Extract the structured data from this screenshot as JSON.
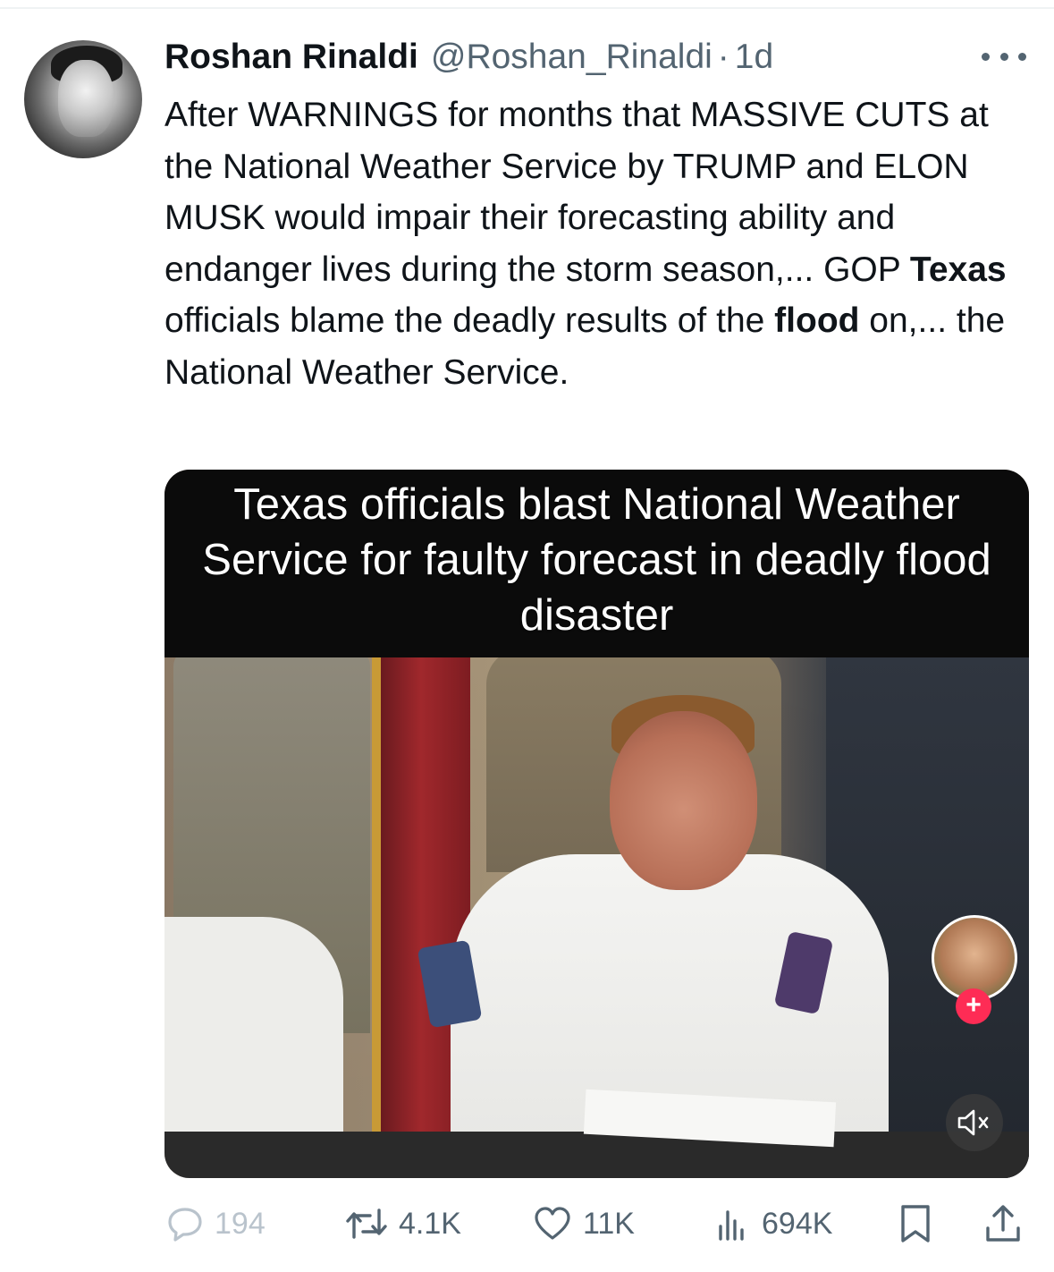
{
  "author": {
    "name": "Roshan Rinaldi",
    "handle": "@Roshan_Rinaldi",
    "separator": "·",
    "time": "1d"
  },
  "tweet": {
    "segments": [
      {
        "text": "After WARNINGS for months that MASSIVE CUTS at the National Weather Service by TRUMP and ELON MUSK would impair their forecasting ability and endanger lives during the storm season,... GOP ",
        "bold": false
      },
      {
        "text": "Texas",
        "bold": true
      },
      {
        "text": " officials blame the deadly results of the ",
        "bold": false
      },
      {
        "text": "flood",
        "bold": true
      },
      {
        "text": " on,... the National Weather Service.",
        "bold": false
      }
    ]
  },
  "media": {
    "headline": "Texas officials blast National Weather Service for faulty forecast in deadly flood disaster",
    "follow_symbol": "+"
  },
  "actions": {
    "replies": "194",
    "reposts": "4.1K",
    "likes": "11K",
    "views": "694K"
  },
  "icons": [
    "more-icon",
    "reply-icon",
    "repost-icon",
    "like-icon",
    "views-icon",
    "bookmark-icon",
    "share-icon",
    "mute-icon"
  ],
  "colors": {
    "text": "#0f1419",
    "secondary": "#536471",
    "follow": "#fe2c55"
  }
}
